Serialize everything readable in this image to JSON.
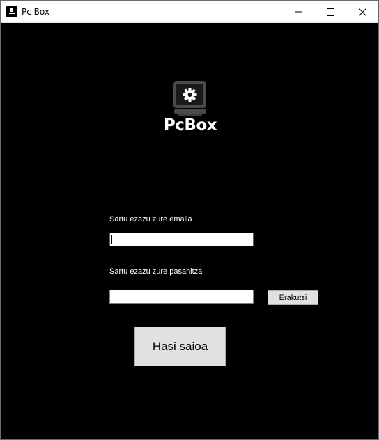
{
  "window": {
    "title": "Pc Box",
    "controls": [
      "minimize-icon",
      "maximize-icon",
      "close-icon"
    ]
  },
  "logo": {
    "icon": "monitor-gear-icon",
    "text": "PcBox"
  },
  "form": {
    "email_label": "Sartu ezazu zure emaila",
    "email_value": "",
    "password_label": "Sartu ezazu zure pasahitza",
    "password_value": "",
    "show_button_label": "Erakutsi",
    "login_button_label": "Hasi saioa"
  },
  "colors": {
    "background": "#000000",
    "button_face": "#e1e1e1",
    "focus_border": "#0078d7",
    "logo_gray": "#4a4a4a"
  }
}
